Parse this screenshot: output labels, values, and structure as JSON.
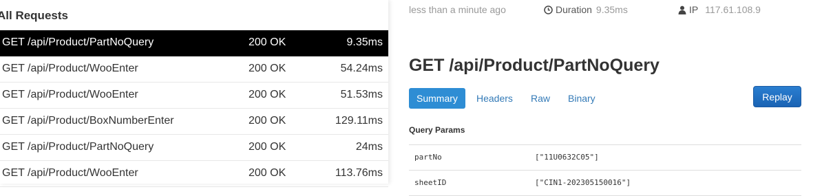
{
  "list": {
    "title": "All Requests",
    "requests": [
      {
        "method_path": "GET /api/Product/PartNoQuery",
        "status": "200 OK",
        "duration": "9.35ms",
        "active": true
      },
      {
        "method_path": "GET /api/Product/WooEnter",
        "status": "200 OK",
        "duration": "54.24ms"
      },
      {
        "method_path": "GET /api/Product/WooEnter",
        "status": "200 OK",
        "duration": "51.53ms"
      },
      {
        "method_path": "GET /api/Product/BoxNumberEnter",
        "status": "200 OK",
        "duration": "129.11ms"
      },
      {
        "method_path": "GET /api/Product/PartNoQuery",
        "status": "200 OK",
        "duration": "24ms"
      },
      {
        "method_path": "GET /api/Product/WooEnter",
        "status": "200 OK",
        "duration": "113.76ms"
      }
    ]
  },
  "meta": {
    "time_ago": "less than a minute ago",
    "duration_label": "Duration",
    "duration_value": "9.35ms",
    "ip_label": "IP",
    "ip_value": "117.61.108.9"
  },
  "detail": {
    "title": "GET /api/Product/PartNoQuery",
    "tabs": [
      "Summary",
      "Headers",
      "Raw",
      "Binary"
    ],
    "active_tab": "Summary",
    "replay_label": "Replay",
    "query_params_title": "Query Params",
    "params": [
      {
        "key": "partNo",
        "value": "[\"11U0632C05\"]"
      },
      {
        "key": "sheetID",
        "value": "[\"CIN1-202305150016\"]"
      }
    ]
  },
  "colors": {
    "accent": "#2e8dd4",
    "link": "#337ab7",
    "active_row": "#000000"
  },
  "icons": [
    "clock-icon",
    "user-icon"
  ]
}
